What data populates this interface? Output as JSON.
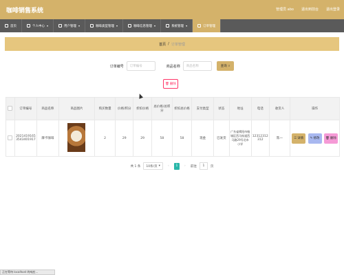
{
  "header": {
    "title": "咖啡销售系统",
    "links": [
      "管理员 abo",
      "退出到前台",
      "退出登录"
    ]
  },
  "nav": [
    {
      "label": "首页",
      "icon": "home-icon",
      "active": false
    },
    {
      "label": "个人中心",
      "icon": "user-icon",
      "active": false
    },
    {
      "label": "用户管理",
      "icon": "users-icon",
      "active": false
    },
    {
      "label": "咖啡类型管理",
      "icon": "category-icon",
      "active": false
    },
    {
      "label": "咖啡信息管理",
      "icon": "coffee-icon",
      "active": false
    },
    {
      "label": "系统管理",
      "icon": "gear-icon",
      "active": false
    },
    {
      "label": "订单管理",
      "icon": "order-icon",
      "active": true
    }
  ],
  "breadcrumb": {
    "home": "首页",
    "sep": "/",
    "current": "订单管理"
  },
  "search": {
    "order_label": "订单编号",
    "order_placeholder": "订单编号",
    "product_label": "商品名称",
    "product_placeholder": "商品名称",
    "search_button": "查询"
  },
  "batch_delete_label": "删除",
  "table": {
    "headers": [
      "订单编号",
      "商品名称",
      "商品图片",
      "购买数量",
      "价格/积分",
      "折扣价格",
      "总价格/总积分",
      "折扣总价格",
      "支付类型",
      "状态",
      "地址",
      "电话",
      "收货人",
      "操作"
    ],
    "rows": [
      {
        "order_no": "20214191653543401917",
        "product": "摩卡咖啡",
        "qty": "2",
        "price": "29",
        "discount_price": "29",
        "total": "58",
        "discount_total": "58",
        "pay_type": "现金",
        "status": "已发货",
        "address": "广东省揭阳市榕城区西马街道西马路29号北市小学",
        "phone": "12312312312",
        "receiver": "陈一"
      }
    ],
    "actions": {
      "detail": "详情",
      "edit": "修改",
      "delete": "删除"
    }
  },
  "pagination": {
    "total": "共 1 条",
    "page_size": "10条/页",
    "current_page": "1",
    "goto_label": "前往",
    "goto_value": "1",
    "page_unit": "页"
  },
  "status_bar": "正在等待 localhost 的响应..."
}
